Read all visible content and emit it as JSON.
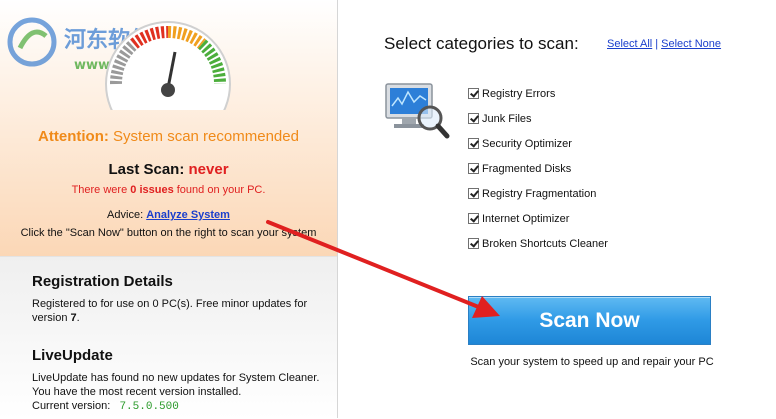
{
  "watermark": {
    "brand": "河东软件园",
    "url": "www.pc0359.cn"
  },
  "left": {
    "attention_label": "Attention:",
    "attention_text": " System scan recommended",
    "last_scan_label": "Last Scan: ",
    "last_scan_value": "never",
    "issues_prefix": "There were ",
    "issues_count": "0 issues",
    "issues_suffix": " found on your PC.",
    "advice_label": "Advice: ",
    "advice_link": "Analyze System",
    "click_hint": "Click the \"Scan Now\" button on the right to scan your system",
    "registration": {
      "title": "Registration Details",
      "text_prefix": "Registered to  for use on 0 PC(s). Free minor updates for version ",
      "version_major": "7",
      "text_suffix": "."
    },
    "liveupdate": {
      "title": "LiveUpdate",
      "text": "LiveUpdate has found no new updates for System Cleaner. You have the most recent version installed.",
      "version_label": "Current version:",
      "version_value": "7.5.0.500"
    }
  },
  "right": {
    "title": "Select categories to scan:",
    "select_all": "Select All",
    "separator": "|",
    "select_none": "Select None",
    "categories": [
      {
        "label": "Registry Errors",
        "checked": true
      },
      {
        "label": "Junk Files",
        "checked": true
      },
      {
        "label": "Security Optimizer",
        "checked": true
      },
      {
        "label": "Fragmented Disks",
        "checked": true
      },
      {
        "label": "Registry Fragmentation",
        "checked": true
      },
      {
        "label": "Internet Optimizer",
        "checked": true
      },
      {
        "label": "Broken Shortcuts Cleaner",
        "checked": true
      }
    ],
    "scan_button": "Scan Now",
    "scan_desc": "Scan your system to speed up and repair your PC"
  },
  "colors": {
    "attention": "#f08a19",
    "error": "#e02020",
    "link": "#1a3ecc",
    "button": "#2f9ae6",
    "version": "#2a9a2a",
    "annotation_arrow": "#e02020"
  },
  "icons": [
    "gauge-icon",
    "monitor-magnifier-icon",
    "checkbox-icon",
    "red-arrow-annotation"
  ]
}
